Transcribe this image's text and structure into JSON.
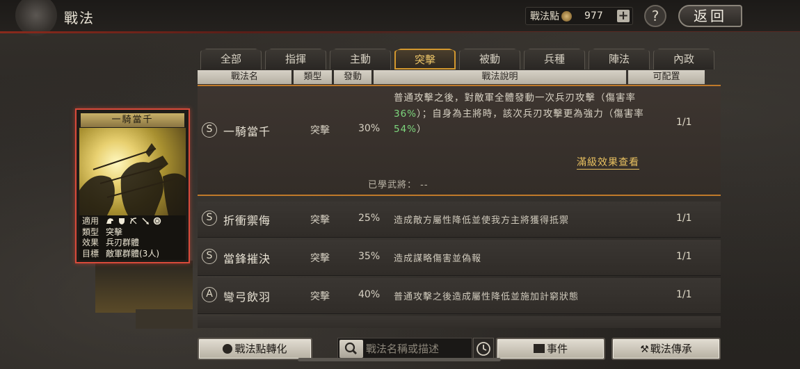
{
  "header": {
    "title": "戰法",
    "points_label": "戰法點",
    "points_value": "977",
    "plus": "+",
    "help": "?",
    "back": "返回"
  },
  "tabs": [
    {
      "label": "全部",
      "active": false
    },
    {
      "label": "指揮",
      "active": false
    },
    {
      "label": "主動",
      "active": false
    },
    {
      "label": "突擊",
      "active": true
    },
    {
      "label": "被動",
      "active": false
    },
    {
      "label": "兵種",
      "active": false
    },
    {
      "label": "陣法",
      "active": false
    },
    {
      "label": "內政",
      "active": false
    }
  ],
  "columns": {
    "name": "戰法名",
    "type": "類型",
    "rate": "發動",
    "desc": "戰法說明",
    "slots": "可配置"
  },
  "expanded": {
    "grade": "S",
    "name": "一騎當千",
    "type": "突擊",
    "rate": "30%",
    "desc_1": "普通攻擊之後，對敵軍全體發動一次兵刃攻擊（傷害率",
    "desc_pct_1": "36%",
    "desc_2": "）；自身為主將時，該次兵刃攻擊更為強力（傷害率",
    "desc_pct_2": "54%",
    "desc_3": "）",
    "slots": "1/1",
    "full_effect_link": "滿級效果查看",
    "learned_label": "已學武將：",
    "learned_value": "--"
  },
  "rows": [
    {
      "grade": "S",
      "name": "折衝禦侮",
      "type": "突擊",
      "rate": "25%",
      "desc": "造成敵方屬性降低並使我方主將獲得抵禦",
      "slots": "1/1"
    },
    {
      "grade": "S",
      "name": "當鋒摧決",
      "type": "突擊",
      "rate": "35%",
      "desc": "造成謀略傷害並偽報",
      "slots": "1/1"
    },
    {
      "grade": "A",
      "name": "彎弓飲羽",
      "type": "突擊",
      "rate": "40%",
      "desc": "普通攻擊之後造成屬性降低並施加計窮狀態",
      "slots": "1/1"
    }
  ],
  "card": {
    "title": "一騎當千",
    "apply_key": "適用",
    "type_key": "類型",
    "type_val": "突擊",
    "effect_key": "效果",
    "effect_val": "兵刃群體",
    "target_key": "目標",
    "target_val": "敵軍群體(3人)",
    "apply_icons": [
      "cavalry-icon",
      "shield-icon",
      "bow-icon",
      "spear-icon",
      "siege-icon"
    ]
  },
  "bottom": {
    "convert": "戰法點轉化",
    "search_placeholder": "戰法名稱或描述",
    "event": "事件",
    "inherit": "戰法傳承"
  },
  "colors": {
    "accent_orange": "#d4982e",
    "highlight_green": "#7ed87e",
    "link_gold": "#e8c060",
    "card_border": "#d84a3a"
  }
}
